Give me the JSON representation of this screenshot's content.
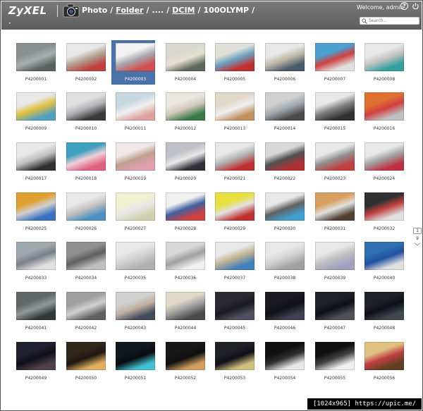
{
  "header": {
    "logo": "ZyXEL",
    "crumbs": [
      {
        "label": "Photo",
        "link": false
      },
      {
        "label": "Folder",
        "link": true
      },
      {
        "label": "....",
        "link": false
      },
      {
        "label": "DCIM",
        "link": true
      },
      {
        "label": "100OLYMP",
        "link": false
      }
    ],
    "separator": "/",
    "welcome": "Welcome, admin",
    "help_icon": "?",
    "search_placeholder": "Search...",
    "menu_dot": "•"
  },
  "selected_index": 2,
  "photos": [
    {
      "name": "P4200001",
      "colors": [
        "#8a9090",
        "#5a6260",
        "#a8b0b0"
      ]
    },
    {
      "name": "P4200002",
      "colors": [
        "#e8e8e8",
        "#c04040",
        "#b0a090"
      ]
    },
    {
      "name": "P4200003",
      "colors": [
        "#f2f2f2",
        "#d05050",
        "#a8a8b0"
      ]
    },
    {
      "name": "P4200004",
      "colors": [
        "#d8d8d0",
        "#5a6a5a",
        "#e8e0d0"
      ]
    },
    {
      "name": "P4200005",
      "colors": [
        "#e0e0d8",
        "#c03030",
        "#6aa0c0"
      ]
    },
    {
      "name": "P4200006",
      "colors": [
        "#e8e8e8",
        "#4a5a6a",
        "#c0b8a8"
      ]
    },
    {
      "name": "P4200007",
      "colors": [
        "#4aa0d0",
        "#e0e0e0",
        "#d04040"
      ]
    },
    {
      "name": "P4200008",
      "colors": [
        "#e8e8e8",
        "#30a0a0",
        "#c0c0c0"
      ]
    },
    {
      "name": "P4200009",
      "colors": [
        "#e8e8e8",
        "#50a0c0",
        "#e0c040"
      ]
    },
    {
      "name": "P4200010",
      "colors": [
        "#e0e0e0",
        "#3a3a3a",
        "#b0b0b8"
      ]
    },
    {
      "name": "P4200011",
      "colors": [
        "#c8d8e0",
        "#e0a0a0",
        "#f0f0f0"
      ]
    },
    {
      "name": "P4200012",
      "colors": [
        "#e8e8e0",
        "#3a7a4a",
        "#d0c8b8"
      ]
    },
    {
      "name": "P4200013",
      "colors": [
        "#e0d8c8",
        "#c09060",
        "#f0f0f0"
      ]
    },
    {
      "name": "P4200014",
      "colors": [
        "#d0d0d0",
        "#4a4a4a",
        "#a0a8b0"
      ]
    },
    {
      "name": "P4200015",
      "colors": [
        "#e8e8e8",
        "#303030",
        "#808080"
      ]
    },
    {
      "name": "P4200016",
      "colors": [
        "#e07030",
        "#c0c0c0",
        "#d04040"
      ]
    },
    {
      "name": "P4200017",
      "colors": [
        "#e8e8e8",
        "#303030",
        "#c0c0c0"
      ]
    },
    {
      "name": "P4200018",
      "colors": [
        "#40a0c0",
        "#e06080",
        "#f0d0d8"
      ]
    },
    {
      "name": "P4200019",
      "colors": [
        "#f0e8e8",
        "#e0a0b0",
        "#c0a090"
      ]
    },
    {
      "name": "P4200020",
      "colors": [
        "#c0c0c8",
        "#303038",
        "#e8e8e8"
      ]
    },
    {
      "name": "P4200021",
      "colors": [
        "#e8e8e8",
        "#c03030",
        "#b0b0b0"
      ]
    },
    {
      "name": "P4200022",
      "colors": [
        "#d8d8d8",
        "#b03030",
        "#505050"
      ]
    },
    {
      "name": "P4200023",
      "colors": [
        "#e8e8e8",
        "#c04040",
        "#909090"
      ]
    },
    {
      "name": "P4200024",
      "colors": [
        "#e8e8e8",
        "#c03040",
        "#a0a0a0"
      ]
    },
    {
      "name": "P4200025",
      "colors": [
        "#e0a030",
        "#3a70c0",
        "#d0d0d0"
      ]
    },
    {
      "name": "P4200026",
      "colors": [
        "#e8e8e8",
        "#4a90c0",
        "#c0c0c0"
      ]
    },
    {
      "name": "P4200027",
      "colors": [
        "#f0f0d0",
        "#d0d0b0",
        "#e8e8e8"
      ]
    },
    {
      "name": "P4200028",
      "colors": [
        "#f0f0f0",
        "#d04040",
        "#4060a0"
      ]
    },
    {
      "name": "P4200029",
      "colors": [
        "#e8e040",
        "#c03030",
        "#e0e0e0"
      ]
    },
    {
      "name": "P4200030",
      "colors": [
        "#e8e8e8",
        "#40a0d0",
        "#606060"
      ]
    },
    {
      "name": "P4200031",
      "colors": [
        "#d8a060",
        "#504030",
        "#e0e0e0"
      ]
    },
    {
      "name": "P4200032",
      "colors": [
        "#303030",
        "#e0e0e0",
        "#c04040"
      ]
    },
    {
      "name": "P4200033",
      "colors": [
        "#a0a8b0",
        "#e0e0e0",
        "#7a8088"
      ]
    },
    {
      "name": "P4200034",
      "colors": [
        "#909090",
        "#c0c0c0",
        "#606060"
      ]
    },
    {
      "name": "P4200035",
      "colors": [
        "#e8e8e8",
        "#b0b0b0",
        "#d0d0d0"
      ]
    },
    {
      "name": "P4200036",
      "colors": [
        "#d8d8d8",
        "#f0f0f0",
        "#a0a0a0"
      ]
    },
    {
      "name": "P4200037",
      "colors": [
        "#e8e8e8",
        "#4080c0",
        "#c0b090"
      ]
    },
    {
      "name": "P4200038",
      "colors": [
        "#e8e8e8",
        "#a0a0a0",
        "#d0d0d0"
      ]
    },
    {
      "name": "P4200039",
      "colors": [
        "#e8e8e8",
        "#a0a0c0",
        "#c0c0c0"
      ]
    },
    {
      "name": "P4200040",
      "colors": [
        "#3070b0",
        "#e0e0e0",
        "#2050a0"
      ]
    },
    {
      "name": "P4200041",
      "colors": [
        "#606868",
        "#303838",
        "#909898"
      ]
    },
    {
      "name": "P4200042",
      "colors": [
        "#a0a0a0",
        "#606060",
        "#d0d0d0"
      ]
    },
    {
      "name": "P4200043",
      "colors": [
        "#d0d0d0",
        "#404a5a",
        "#c0b0a0"
      ]
    },
    {
      "name": "P4200044",
      "colors": [
        "#e0d8c8",
        "#4a4a4a",
        "#a0a0a0"
      ]
    },
    {
      "name": "P4200045",
      "colors": [
        "#2a2a30",
        "#505060",
        "#1a1a20"
      ]
    },
    {
      "name": "P4200046",
      "colors": [
        "#1a1a20",
        "#404050",
        "#101018"
      ]
    },
    {
      "name": "P4200047",
      "colors": [
        "#202028",
        "#505058",
        "#101018"
      ]
    },
    {
      "name": "P4200048",
      "colors": [
        "#202028",
        "#404850",
        "#101018"
      ]
    },
    {
      "name": "P4200049",
      "colors": [
        "#202030",
        "#504048",
        "#10101a"
      ]
    },
    {
      "name": "P4200050",
      "colors": [
        "#302818",
        "#e0b060",
        "#201810"
      ]
    },
    {
      "name": "P4200051",
      "colors": [
        "#101820",
        "#40c0d0",
        "#080c10"
      ]
    },
    {
      "name": "P4200052",
      "colors": [
        "#181818",
        "#d0a060",
        "#101010"
      ]
    },
    {
      "name": "P4200053",
      "colors": [
        "#202028",
        "#d0c080",
        "#101018"
      ]
    },
    {
      "name": "P4200054",
      "colors": [
        "#101010",
        "#e8e8e8",
        "#303030"
      ]
    },
    {
      "name": "P4200055",
      "colors": [
        "#101010",
        "#f0f0f0",
        "#404040"
      ]
    },
    {
      "name": "P4200056",
      "colors": [
        "#e0c080",
        "#604020",
        "#c04040"
      ]
    }
  ],
  "pager": {
    "current": "1",
    "total": "9"
  },
  "watermark": "[1024x965] https://upic.me/"
}
